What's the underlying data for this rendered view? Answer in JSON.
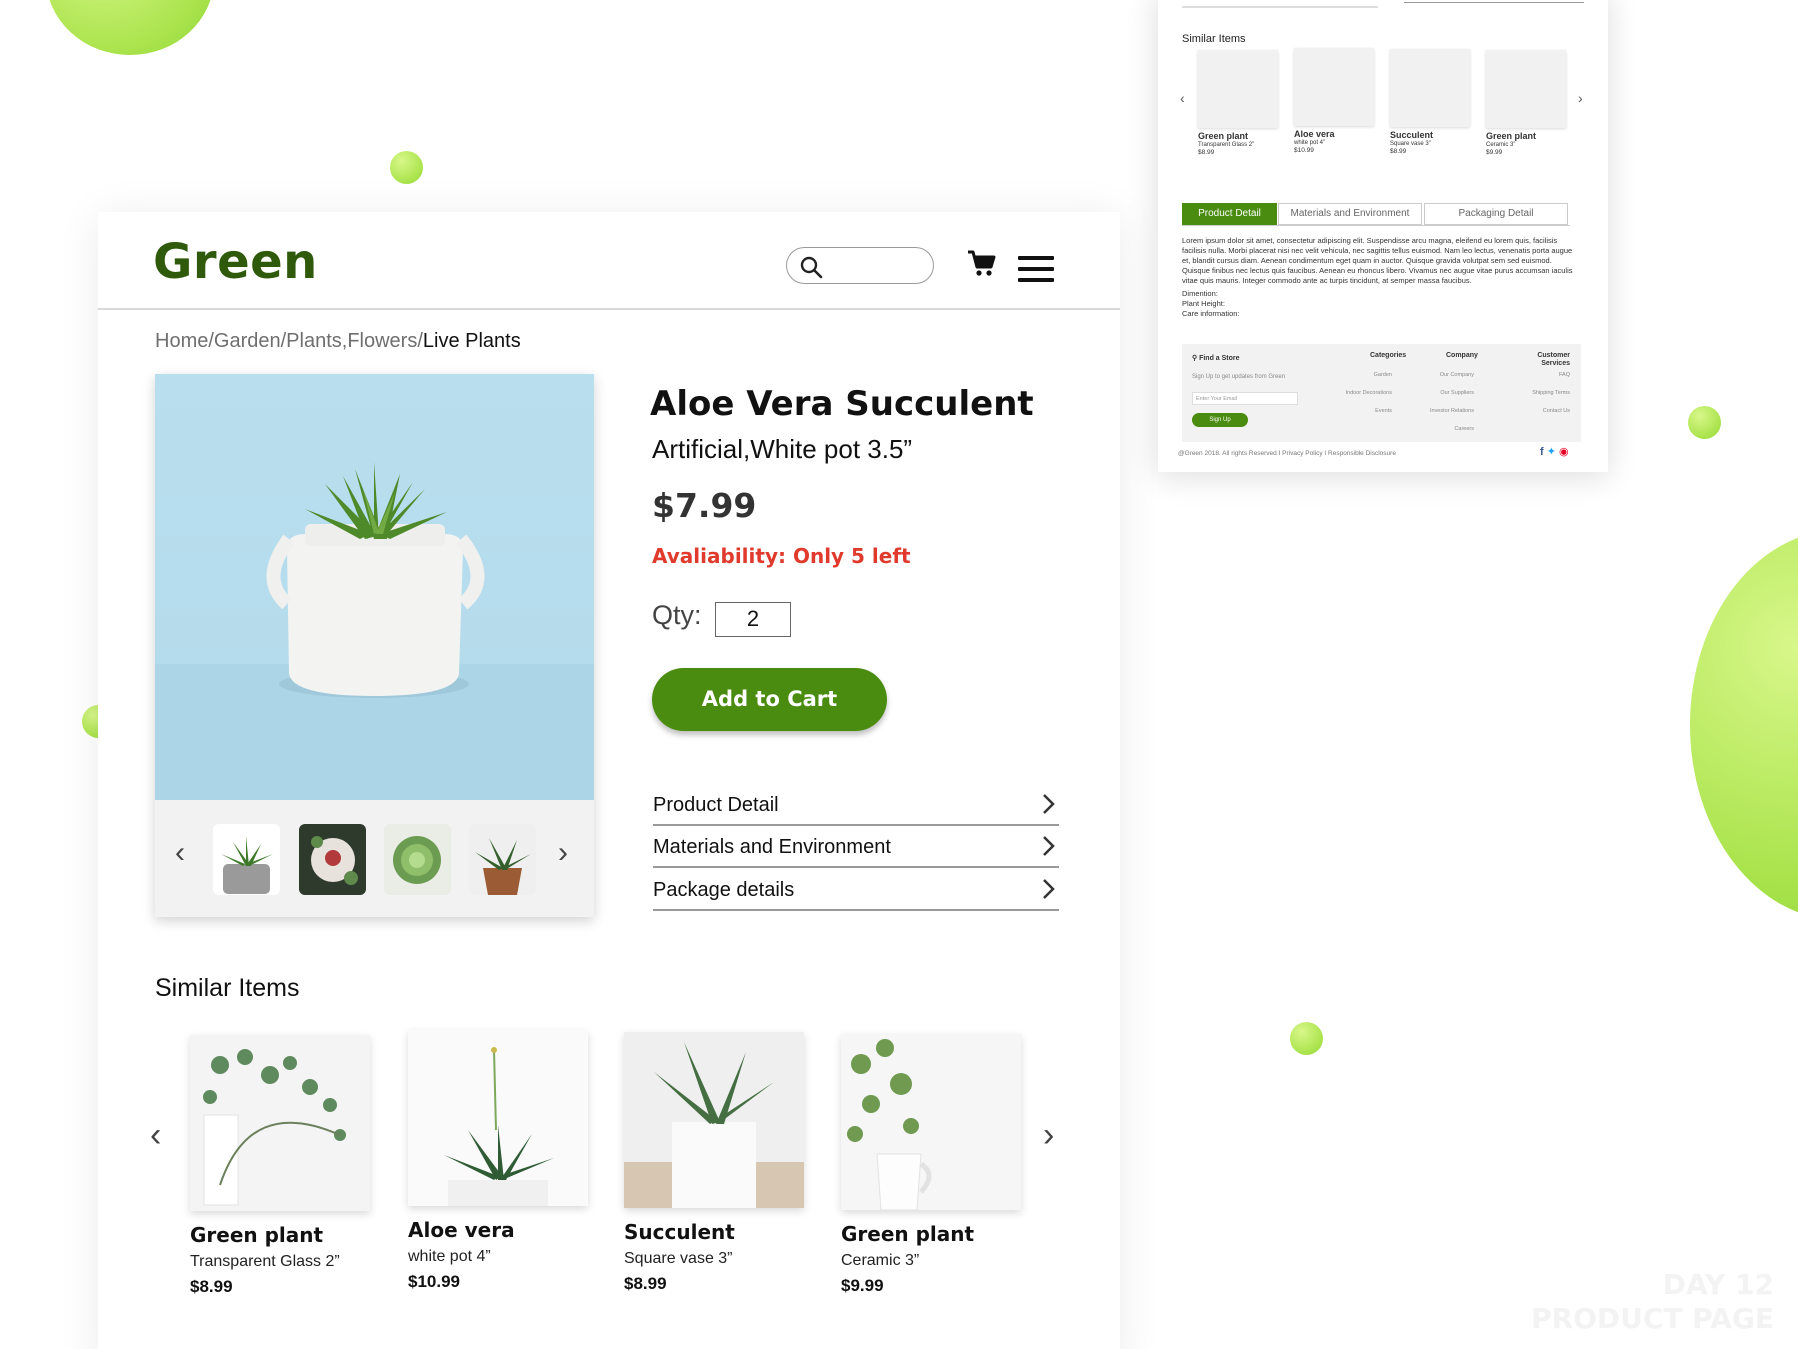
{
  "colors": {
    "brand": "#2f5a0c",
    "button": "#4a8c10",
    "alert": "#e03a2d",
    "accent_blob": "#a9e34b"
  },
  "header": {
    "logo": "Green",
    "search_placeholder": ""
  },
  "breadcrumb": {
    "path": "Home/Garden/Plants,Flowers/",
    "current": "Live Plants"
  },
  "product": {
    "title": "Aloe Vera Succulent",
    "subtitle": "Artificial,White pot 3.5”",
    "price": "$7.99",
    "availability": "Avaliability: Only 5 left",
    "qty_label": "Qty:",
    "qty_value": "2",
    "add_to_cart": "Add to Cart"
  },
  "accordion": [
    {
      "label": "Product Detail"
    },
    {
      "label": "Materials and Environment"
    },
    {
      "label": "Package details"
    }
  ],
  "similar": {
    "title": "Similar Items",
    "items": [
      {
        "name": "Green plant",
        "desc": "Transparent Glass 2”",
        "price": "$8.99"
      },
      {
        "name": "Aloe vera",
        "desc": "white pot 4”",
        "price": "$10.99"
      },
      {
        "name": "Succulent",
        "desc": "Square vase 3”",
        "price": "$8.99"
      },
      {
        "name": "Green plant",
        "desc": "Ceramic 3”",
        "price": "$9.99"
      }
    ]
  },
  "mini": {
    "similar_title": "Similar Items",
    "items": [
      {
        "name": "Green plant",
        "desc": "Transparent Glass 2”",
        "price": "$8.99"
      },
      {
        "name": "Aloe vera",
        "desc": "white pot 4”",
        "price": "$10.99"
      },
      {
        "name": "Succulent",
        "desc": "Square vase 3”",
        "price": "$8.99"
      },
      {
        "name": "Green plant",
        "desc": "Ceramic 3”",
        "price": "$9.99"
      }
    ],
    "tabs": [
      "Product Detail",
      "Materials and Environment",
      "Packaging Detail"
    ],
    "lorem": "Lorem ipsum dolor sit amet, consectetur adipiscing elit. Suspendisse arcu magna, eleifend eu lorem quis, facilisis facilisis nulla. Morbi placerat nisi nec velit vehicula, nec sagittis tellus euismod. Nam leo lectus, venenatis porta augue et, blandit cursus diam. Aenean condimentum eget quam in auctor. Quisque gravida volutpat sem sed euismod. Quisque finibus nec lectus quis faucibus. Aenean eu rhoncus libero. Vivamus nec augue vitae purus accumsan iaculis vitae quis mauris. Integer commodo ante ac turpis tincidunt, at semper massa faucibus.",
    "dimention": "Dimention:",
    "plant_height": "Plant Height:",
    "care": "Care information:",
    "footer": {
      "find_store": "Find a Store",
      "signup_text": "Sign Up to get updates from Green",
      "email_placeholder": "Enter Your Email",
      "signup_btn": "Sign Up",
      "categories_title": "Categories",
      "categories": [
        "Garden",
        "Indoor Decorations",
        "Events"
      ],
      "company_title": "Company",
      "company": [
        "Our Company",
        "Our Suppliers",
        "Investor Relations",
        "Careers"
      ],
      "service_title": "Customer Services",
      "service": [
        "FAQ",
        "Shipping Terms",
        "Contact Us"
      ],
      "copyright": "@Green 2018. All rights Reserved I Privacy Policy I Responsible Disclosure"
    }
  },
  "watermark": {
    "line1": "DAY 12",
    "line2": "PRODUCT PAGE"
  }
}
